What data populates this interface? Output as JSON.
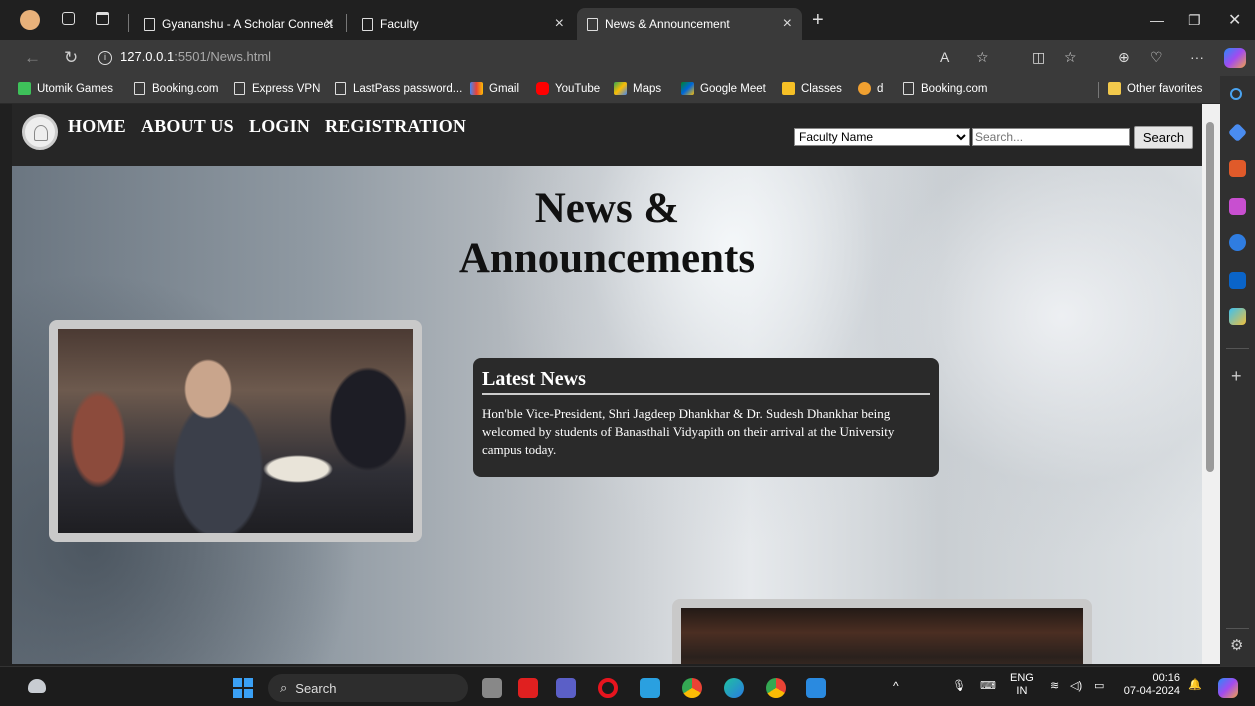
{
  "browser": {
    "tabs": [
      {
        "label": "Gyananshu - A Scholar Connect",
        "active": false
      },
      {
        "label": "Faculty",
        "active": false
      },
      {
        "label": "News & Announcement",
        "active": true
      }
    ],
    "url_host": "127.0.0.1",
    "url_path": ":5501/News.html",
    "bookmarks": [
      "Utomik Games",
      "Booking.com",
      "Express VPN",
      "LastPass password...",
      "Gmail",
      "YouTube",
      "Maps",
      "Google Meet",
      "Classes",
      "d",
      "Booking.com"
    ],
    "other_favorites": "Other favorites"
  },
  "site": {
    "nav": [
      "HOME",
      "ABOUT US",
      "LOGIN",
      "REGISTRATION"
    ],
    "search": {
      "select_value": "Faculty Name",
      "placeholder": "Search...",
      "button": "Search"
    },
    "title_line1": "News &",
    "title_line2": "Announcements",
    "news": {
      "heading": "Latest News",
      "body": "Hon'ble Vice-President, Shri Jagdeep Dhankhar & Dr. Sudesh Dhankhar being welcomed by students of Banasthali Vidyapith on their arrival at the University campus today."
    }
  },
  "taskbar": {
    "search": "Search",
    "lang_top": "ENG",
    "lang_bottom": "IN",
    "time": "00:16",
    "date": "07-04-2024"
  },
  "colors": {
    "nav_bg": "#262626",
    "card_bg": "#2a2a2a",
    "chrome_bg": "#202020",
    "toolbar_bg": "#3a3a3a"
  }
}
